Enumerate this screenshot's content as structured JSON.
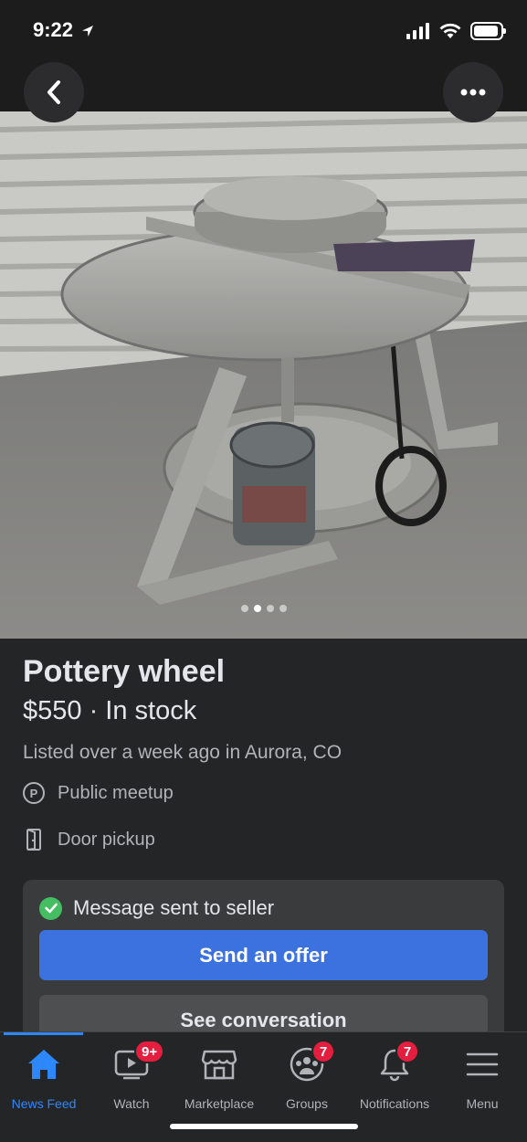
{
  "status_bar": {
    "time": "9:22"
  },
  "header": {
    "back_icon": "chevron-left-icon",
    "more_icon": "more-horizontal-icon"
  },
  "photo": {
    "description_icon": "pottery-wheel-photo",
    "page_count": 4,
    "active_page": 2
  },
  "listing": {
    "title": "Pottery wheel",
    "price_line": "$550 · In stock",
    "listed": "Listed over a week ago in Aurora, CO",
    "meetup": "Public meetup",
    "meetup_icon_letter": "P",
    "pickup": "Door pickup"
  },
  "message_card": {
    "status": "Message sent to seller",
    "offer_button": "Send an offer",
    "conversation_button": "See conversation"
  },
  "tabs": [
    {
      "label": "News Feed",
      "badge": ""
    },
    {
      "label": "Watch",
      "badge": "9+"
    },
    {
      "label": "Marketplace",
      "badge": ""
    },
    {
      "label": "Groups",
      "badge": "7"
    },
    {
      "label": "Notifications",
      "badge": "7"
    },
    {
      "label": "Menu",
      "badge": ""
    }
  ],
  "colors": {
    "accent": "#2d88ff",
    "badge": "#e41e3f",
    "success": "#45bd62"
  }
}
